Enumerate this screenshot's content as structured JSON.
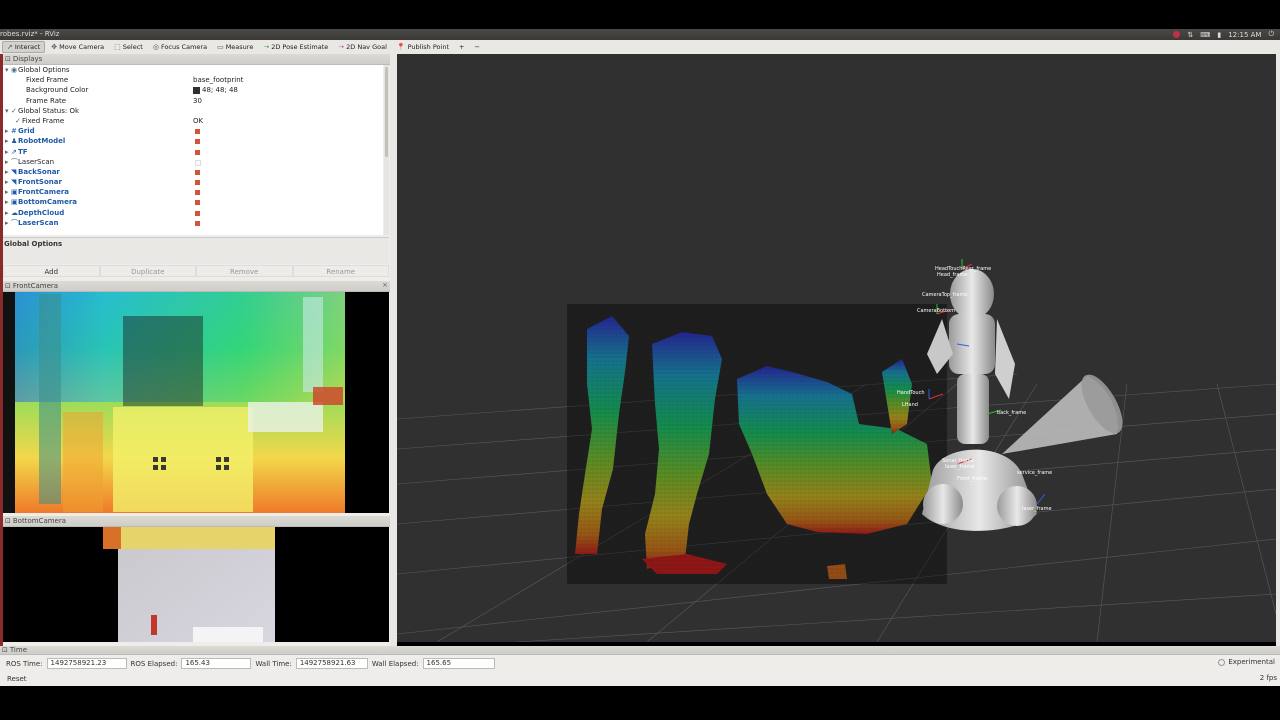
{
  "window": {
    "title": "robes.rviz* - RViz",
    "clock": "12:15 AM"
  },
  "toolbar": {
    "tools": [
      {
        "label": "Interact",
        "icon": "cursor-icon",
        "active": true
      },
      {
        "label": "Move Camera",
        "icon": "move-camera-icon"
      },
      {
        "label": "Select",
        "icon": "select-box-icon"
      },
      {
        "label": "Focus Camera",
        "icon": "focus-icon"
      },
      {
        "label": "Measure",
        "icon": "ruler-icon"
      },
      {
        "label": "2D Pose Estimate",
        "icon": "green-arrow-icon"
      },
      {
        "label": "2D Nav Goal",
        "icon": "pink-arrow-icon"
      },
      {
        "label": "Publish Point",
        "icon": "red-pin-icon"
      }
    ],
    "add_symbol": "+",
    "remove_symbol": "−"
  },
  "displays": {
    "panel_title": "Displays",
    "rows": [
      {
        "label": "Global Options",
        "indent": 0,
        "arrow": "▾",
        "icon": "◉",
        "blue": false,
        "value": ""
      },
      {
        "label": "Fixed Frame",
        "indent": 2,
        "arrow": "",
        "icon": "",
        "blue": false,
        "value": "base_footprint"
      },
      {
        "label": "Background Color",
        "indent": 2,
        "arrow": "",
        "icon": "",
        "blue": false,
        "value": "48; 48; 48",
        "swatch": true
      },
      {
        "label": "Frame Rate",
        "indent": 2,
        "arrow": "",
        "icon": "",
        "blue": false,
        "value": "30"
      },
      {
        "label": "Global Status: Ok",
        "indent": 0,
        "arrow": "▾",
        "icon": "✓",
        "blue": false,
        "value": ""
      },
      {
        "label": "Fixed Frame",
        "indent": 1,
        "arrow": "",
        "icon": "✓",
        "blue": false,
        "value": "OK"
      },
      {
        "label": "Grid",
        "indent": 0,
        "arrow": "▸",
        "icon": "#",
        "blue": true,
        "value": "",
        "check": true
      },
      {
        "label": "RobotModel",
        "indent": 0,
        "arrow": "▸",
        "icon": "♟",
        "blue": true,
        "value": "",
        "check": true
      },
      {
        "label": "TF",
        "indent": 0,
        "arrow": "▸",
        "icon": "⇗",
        "blue": true,
        "value": "",
        "check": true
      },
      {
        "label": "LaserScan",
        "indent": 0,
        "arrow": "▸",
        "icon": "⌒",
        "blue": false,
        "value": "",
        "check": false
      },
      {
        "label": "BackSonar",
        "indent": 0,
        "arrow": "▸",
        "icon": "◥",
        "blue": true,
        "value": "",
        "check": true
      },
      {
        "label": "FrontSonar",
        "indent": 0,
        "arrow": "▸",
        "icon": "◥",
        "blue": true,
        "value": "",
        "check": true
      },
      {
        "label": "FrontCamera",
        "indent": 0,
        "arrow": "▸",
        "icon": "▣",
        "blue": true,
        "value": "",
        "check": true
      },
      {
        "label": "BottomCamera",
        "indent": 0,
        "arrow": "▸",
        "icon": "▣",
        "blue": true,
        "value": "",
        "check": true
      },
      {
        "label": "DepthCloud",
        "indent": 0,
        "arrow": "▸",
        "icon": "☁",
        "blue": true,
        "value": "",
        "check": true
      },
      {
        "label": "LaserScan",
        "indent": 0,
        "arrow": "▸",
        "icon": "⌒",
        "blue": true,
        "value": "",
        "check": true
      }
    ],
    "description_title": "Global Options",
    "buttons": {
      "add": "Add",
      "duplicate": "Duplicate",
      "remove": "Remove",
      "rename": "Rename"
    }
  },
  "front_camera": {
    "title": "FrontCamera"
  },
  "bottom_camera": {
    "title": "BottomCamera"
  },
  "viewport": {
    "frame_labels": [
      "HeadTouchRear_frame",
      "Head_frame",
      "CameraTop_frame",
      "CameraBottom",
      "HandTouch",
      "LHand",
      "back_frame",
      "service_frame",
      "Sonar_frame",
      "laser_frame",
      "Front_frame",
      "laser_frame"
    ]
  },
  "time": {
    "panel_title": "Time",
    "ros_time_label": "ROS Time:",
    "ros_time": "1492758921.23",
    "ros_elapsed_label": "ROS Elapsed:",
    "ros_elapsed": "165.43",
    "wall_time_label": "Wall Time:",
    "wall_time": "1492758921.63",
    "wall_elapsed_label": "Wall Elapsed:",
    "wall_elapsed": "165.65",
    "reset": "Reset",
    "experimental": "Experimental",
    "fps": "2 fps"
  }
}
